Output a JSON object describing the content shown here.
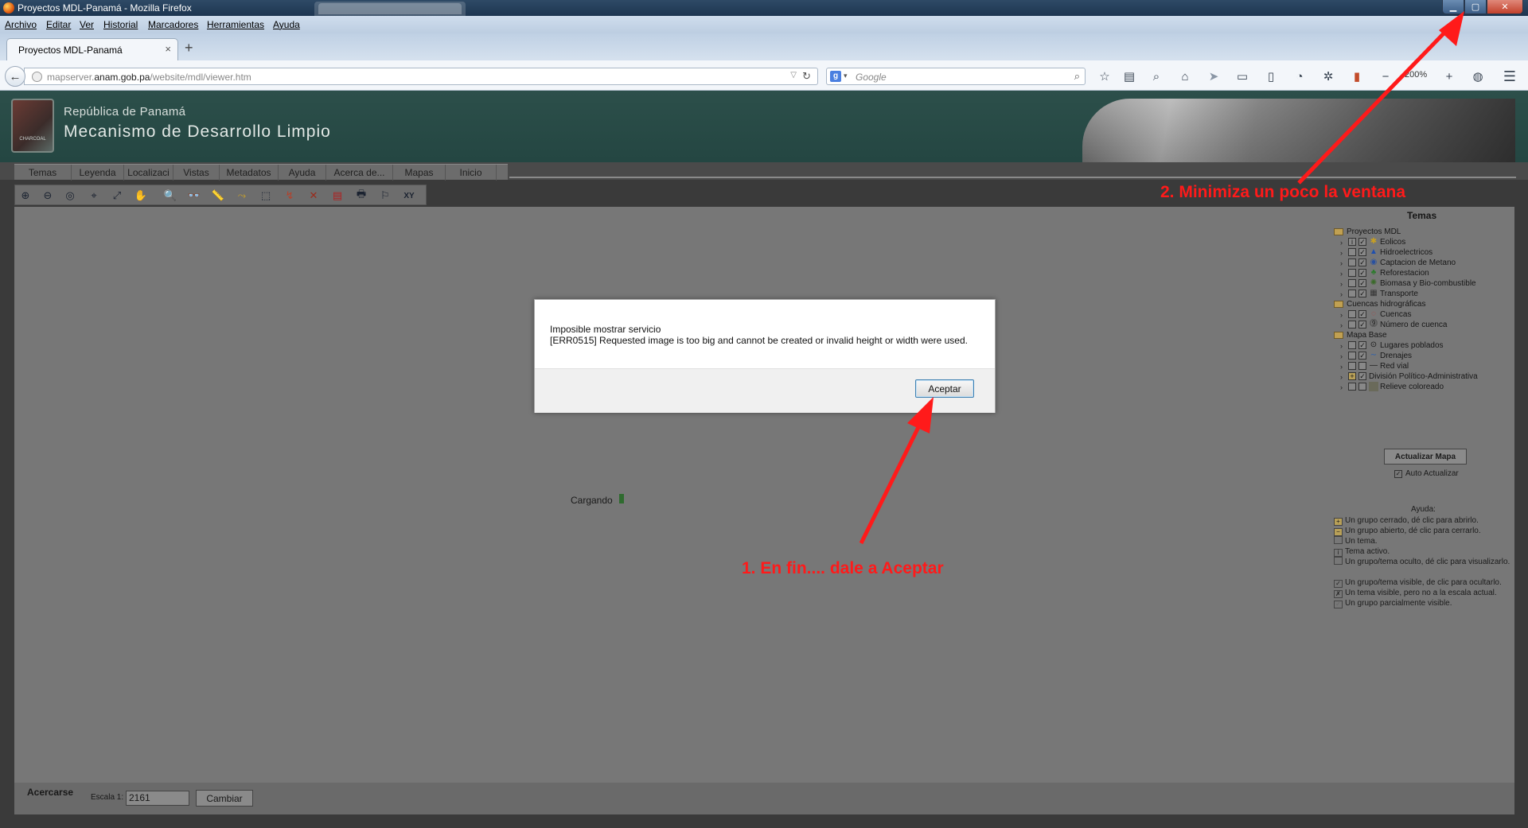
{
  "window": {
    "title": "Proyectos MDL-Panamá - Mozilla Firefox",
    "controls": {
      "minimize": "▁",
      "maximize": "▢",
      "close": "✕"
    }
  },
  "menubar": [
    "Archivo",
    "Editar",
    "Ver",
    "Historial",
    "Marcadores",
    "Herramientas",
    "Ayuda"
  ],
  "tabs": [
    {
      "label": "Proyectos MDL-Panamá",
      "close": "×"
    }
  ],
  "new_tab": "+",
  "nav": {
    "back": "←",
    "url_host_prefix": "mapserver.",
    "url_host_main": "anam.gob.pa",
    "url_path": "/website/mdl/viewer.htm",
    "url_dropdown": "▽",
    "reload": "↻",
    "search_engine": "g",
    "search_dropdown": "▾",
    "search_placeholder": "Google",
    "search_icon": "⌕",
    "zoom": "200%",
    "zoom_out": "−",
    "zoom_in": "+",
    "menu": "☰"
  },
  "banner": {
    "republic": "República de Panamá",
    "mechanism": "Mecanismo de Desarrollo Limpio",
    "logo_caption": "CHARCOAL"
  },
  "nav_tabs": [
    "Temas",
    "Leyenda",
    "Localizaci",
    "Vistas",
    "Metadatos",
    "Ayuda",
    "Acerca de...",
    "Mapas",
    "Inicio"
  ],
  "toolbar": [
    "⊕",
    "⊖",
    "◎",
    "⌖",
    "⤢",
    "✋",
    "🔍",
    "👓",
    "📏",
    "⤳",
    "⬚",
    "↯",
    "✕",
    "▤",
    "🖶",
    "⚐",
    "XY"
  ],
  "map": {
    "loading": "Cargando"
  },
  "themes": {
    "title": "Temas",
    "groups": [
      {
        "label": "Proyectos MDL",
        "items": [
          "Eolicos",
          "Hidroelectricos",
          "Captacion de Metano",
          "Reforestacion",
          "Biomasa y Bio-combustible",
          "Transporte"
        ]
      },
      {
        "label": "Cuencas hidrográficas",
        "items": [
          "Cuencas",
          "Número de cuenca"
        ]
      },
      {
        "label": "Mapa Base",
        "items": [
          "Lugares poblados",
          "Drenajes",
          "Red vial",
          "División Político-Administrativa",
          "Relieve coloreado"
        ]
      }
    ],
    "update_button": "Actualizar Mapa",
    "auto_update": "Auto Actualizar",
    "help_title": "Ayuda:",
    "help_items": [
      "Un grupo cerrado, dé clic para abrirlo.",
      "Un grupo abierto, dé clic para cerrarlo.",
      "Un tema.",
      "Tema activo.",
      "Un grupo/tema oculto, dé clic para visualizarlo.",
      "Un grupo/tema visible, de clic para ocultarlo.",
      "Un tema visible, pero no a la escala actual.",
      "Un grupo parcialmente visible."
    ]
  },
  "bottom": {
    "mode": "Acercarse",
    "scale_label": "Escala 1:",
    "scale_value": "2161",
    "change_button": "Cambiar"
  },
  "dialog": {
    "title": "Imposible mostrar servicio",
    "body": "[ERR0515] Requested image is too big and cannot be created or invalid height or width were used.",
    "accept": "Aceptar"
  },
  "annotations": {
    "step1": "1. En fin.... dale a Aceptar",
    "step2": "2. Minimiza un poco la ventana",
    "color": "#ff1a1a"
  }
}
